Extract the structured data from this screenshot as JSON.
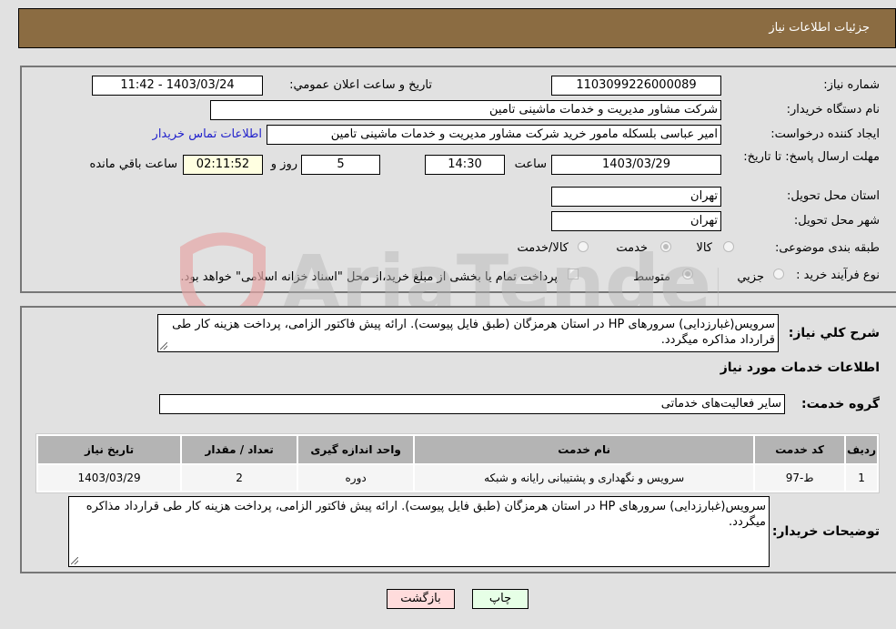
{
  "header": {
    "title": "جزئیات اطلاعات نیاز"
  },
  "details": {
    "need_number_label": "شماره نیاز:",
    "need_number": "1103099226000089",
    "announce_label": "تاریخ و ساعت اعلان عمومي:",
    "announce_value": "1403/03/24 - 11:42",
    "buyer_org_label": "نام دستگاه خريدار:",
    "buyer_org": "شرکت مشاور مدیریت و خدمات ماشینی تامین",
    "creator_label": "ایجاد کننده درخواست:",
    "creator": "امیر عباسی بلسکله مامور خرید شرکت مشاور مدیریت و خدمات ماشینی تامین",
    "contact_link": "اطلاعات تماس خریدار",
    "deadline_label": "مهلت ارسال پاسخ: تا تاریخ:",
    "deadline_date": "1403/03/29",
    "time_label": "ساعت",
    "deadline_time": "14:30",
    "days_value": "5",
    "days_label": "روز و",
    "remaining_time": "02:11:52",
    "remaining_label": "ساعت باقي مانده",
    "province_label": "استان محل تحویل:",
    "province": "تهران",
    "city_label": "شهر محل تحویل:",
    "city": "تهران",
    "category_label": "طبقه بندی موضوعی:",
    "category_options": [
      {
        "label": "کالا",
        "checked": false
      },
      {
        "label": "خدمت",
        "checked": true
      },
      {
        "label": "کالا/خدمت",
        "checked": false
      }
    ],
    "process_label": "نوع فرآیند خرید :",
    "process_options": [
      {
        "label": "جزيي",
        "checked": false
      },
      {
        "label": "متوسط",
        "checked": true
      }
    ],
    "treasury_note": "پرداخت تمام یا بخشی از مبلغ خرید،از محل \"اسناد خزانه اسلامی\" خواهد بود."
  },
  "summary": {
    "description_label": "شرح کلي نياز:",
    "description": "سرویس(غبارزدایی) سرورهای HP در استان هرمزگان (طبق فایل پیوست). ارائه پیش فاکتور الزامی، پرداخت هزینه کار طی قرارداد مذاکره میگردد.",
    "services_heading": "اطلاعات خدمات مورد نياز",
    "service_group_label": "گروه خدمت:",
    "service_group": "سایر فعالیت‌های خدماتی"
  },
  "table": {
    "headers": [
      "رديف",
      "کد خدمت",
      "نام خدمت",
      "واحد اندازه گيری",
      "تعداد / مقدار",
      "تاريخ نياز"
    ],
    "rows": [
      [
        "1",
        "ط-97",
        "سرویس و نگهداری و پشتیبانی رایانه و شبکه",
        "دوره",
        "2",
        "1403/03/29"
      ]
    ]
  },
  "buyer_notes": {
    "label": "توضيحات خريدار:",
    "text": "سرویس(غبارزدایی) سرورهای HP در استان هرمزگان (طبق فایل پیوست). ارائه پیش فاکتور الزامی، پرداخت هزینه کار طی قرارداد مذاکره میگردد."
  },
  "buttons": {
    "print": "چاپ",
    "back": "بازگشت"
  },
  "watermark": {
    "text": "AriaTender.neT"
  },
  "colors": {
    "header_bg": "#8b6c42",
    "page_bg": "#e1e1e1",
    "link": "#2222cc",
    "back_btn": "#ffdcdc",
    "print_btn": "#e6ffe6",
    "remaining_bg": "#ffffe1"
  }
}
